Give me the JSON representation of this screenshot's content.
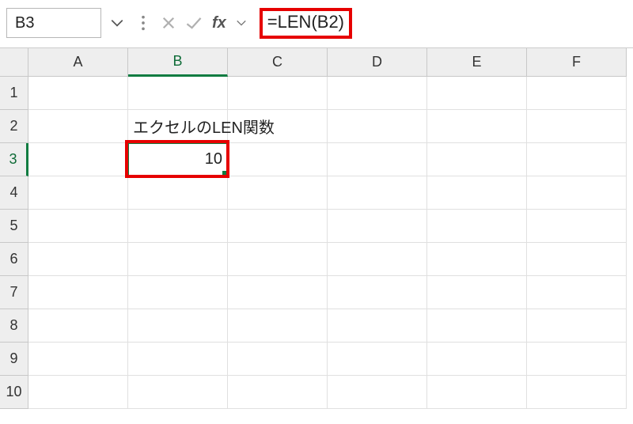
{
  "name_box_value": "B3",
  "formula_text": "=LEN(B2)",
  "columns": [
    "A",
    "B",
    "C",
    "D",
    "E",
    "F"
  ],
  "rows": [
    "1",
    "2",
    "3",
    "4",
    "5",
    "6",
    "7",
    "8",
    "9",
    "10"
  ],
  "active_col_index": 1,
  "active_row_index": 2,
  "cells": {
    "B2": "エクセルのLEN関数",
    "B3": "10"
  }
}
